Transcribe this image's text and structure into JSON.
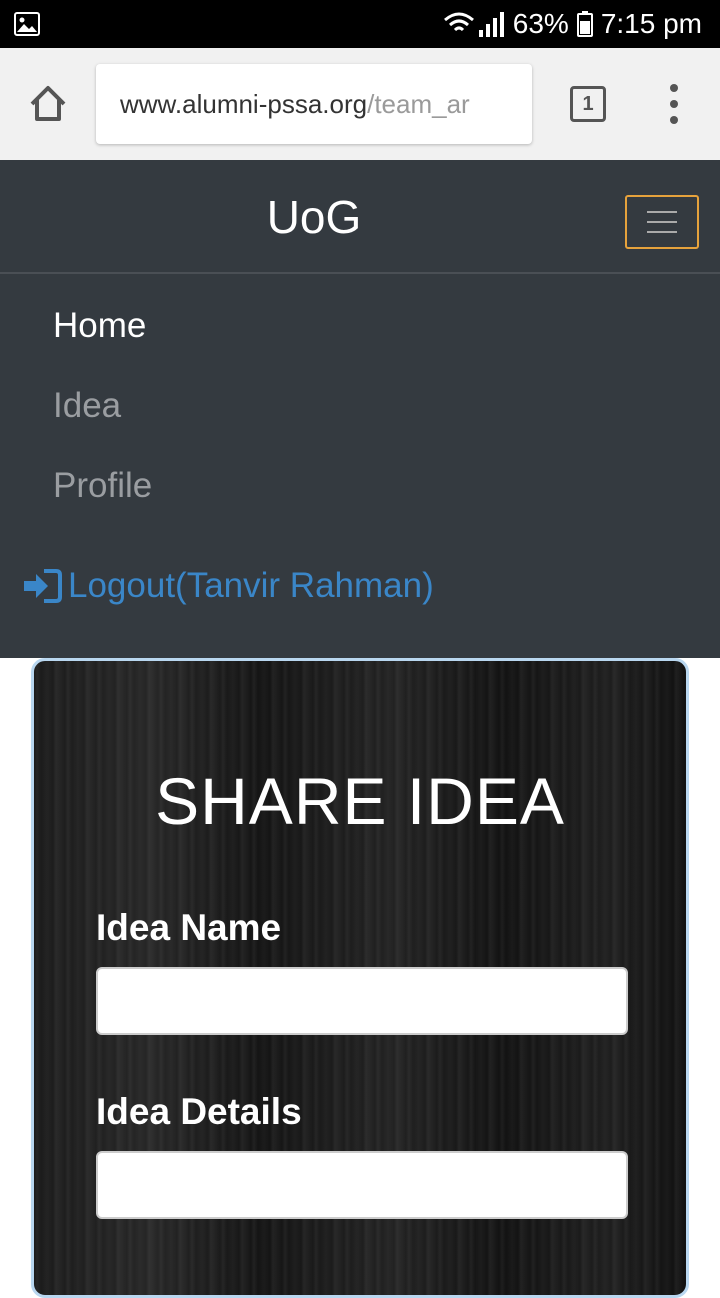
{
  "status_bar": {
    "battery_percent": "63%",
    "time": "7:15 pm",
    "icons": [
      "gallery-icon",
      "wifi-icon",
      "signal-icon",
      "battery-icon"
    ]
  },
  "browser": {
    "url_domain": "www.alumni-pssa.org",
    "url_path": "/team_ar",
    "tab_count": "1",
    "icons": [
      "home-icon",
      "tabs-icon",
      "overflow-menu-icon"
    ]
  },
  "navbar": {
    "brand": "UoG",
    "items": [
      {
        "label": "Home",
        "active": true
      },
      {
        "label": "Idea",
        "active": false
      },
      {
        "label": "Profile",
        "active": false
      }
    ],
    "logout_label": "Logout(Tanvir Rahman)",
    "toggler_border_color": "#e6a23c",
    "link_color": "#3a86c8",
    "background_color": "#343a40"
  },
  "form": {
    "title": "SHARE IDEA",
    "idea_name_label": "Idea Name",
    "idea_name_value": "",
    "idea_details_label": "Idea Details",
    "idea_details_value": ""
  }
}
